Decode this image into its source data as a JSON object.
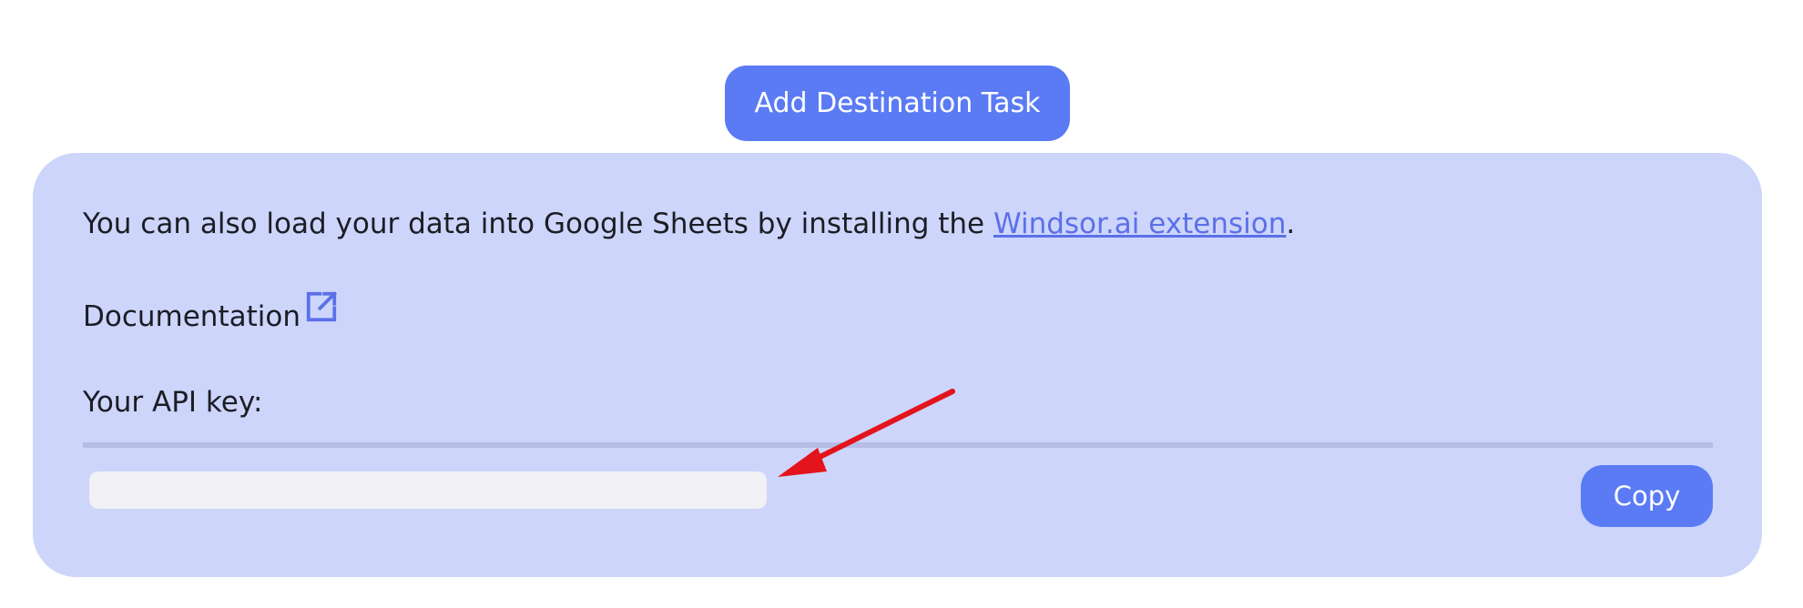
{
  "header": {
    "add_destination_label": "Add Destination Task"
  },
  "panel": {
    "info_prefix": "You can also load your data into Google Sheets by installing the ",
    "info_link": "Windsor.ai extension",
    "info_suffix": ".",
    "documentation_label": "Documentation",
    "documentation_icon": "external-link-icon",
    "api_key_label": "Your API key:",
    "api_key_value": "",
    "copy_label": "Copy"
  },
  "annotation": {
    "arrow_icon": "red-arrow-icon",
    "arrow_color": "#e3141b"
  },
  "colors": {
    "accent": "#5b7bf5",
    "panel_bg": "#cdd5fb",
    "link": "#5b70e8",
    "field_bg": "#f1f1f6"
  }
}
